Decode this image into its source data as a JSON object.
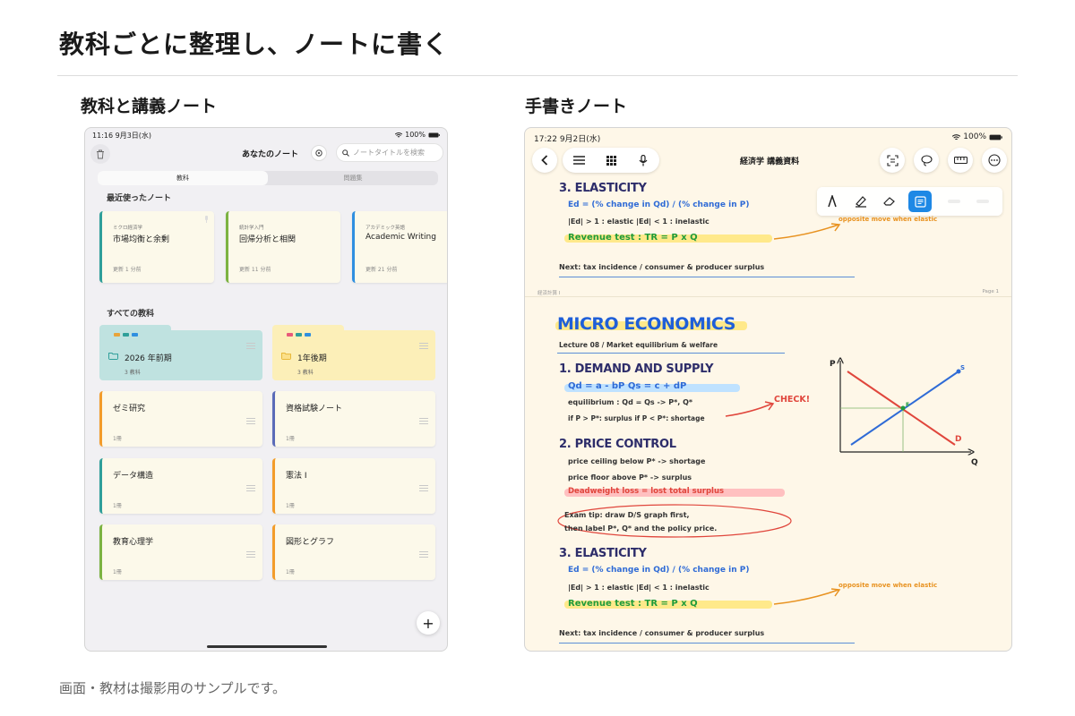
{
  "page": {
    "title": "教科ごとに整理し、ノートに書く",
    "left_section_title": "教科と講義ノート",
    "right_section_title": "手書きノート",
    "footnote": "画面・教材は撮影用のサンプルです。"
  },
  "left_device": {
    "status": {
      "time": "11:16",
      "date": "9月3日(水)",
      "battery": "100%"
    },
    "header_title": "あなたのノート",
    "search_placeholder": "ノートタイトルを検索",
    "segments": [
      "教科",
      "問題集"
    ],
    "recent_label": "最近使ったノート",
    "recent_notes": [
      {
        "subject": "ミクロ経済学",
        "name": "市場均衡と余剰",
        "updated": "更新 1 分前",
        "color": "#2f9f9a"
      },
      {
        "subject": "統計学入門",
        "name": "回帰分析と相関",
        "updated": "更新 11 分前",
        "color": "#7cb342"
      },
      {
        "subject": "アカデミック英語",
        "name": "Academic Writing",
        "updated": "更新 21 分前",
        "color": "#2f8fe0"
      }
    ],
    "all_subjects_label": "すべての教科",
    "folders": [
      {
        "name": "2026 年前期",
        "count": "3 教科",
        "color": "#bfe2e0"
      },
      {
        "name": "1年後期",
        "count": "3 教科",
        "color": "#fcefb8"
      }
    ],
    "subjects": [
      {
        "name": "ゼミ研究",
        "count": "1冊",
        "color": "#f39c2a"
      },
      {
        "name": "資格試験ノート",
        "count": "1冊",
        "color": "#5b6bb8"
      },
      {
        "name": "データ構造",
        "count": "1冊",
        "color": "#2f9f9a"
      },
      {
        "name": "憲法 I",
        "count": "1冊",
        "color": "#f39c2a"
      },
      {
        "name": "教育心理学",
        "count": "1冊",
        "color": "#7cb342"
      },
      {
        "name": "図形とグラフ",
        "count": "1冊",
        "color": "#f39c2a"
      }
    ],
    "fab": "+"
  },
  "right_device": {
    "status": {
      "time": "17:22",
      "date": "9月2日(水)",
      "battery": "100%"
    },
    "header_title": "経済学 講義資料",
    "page_label_left": "経済計算 I",
    "page_label_right": "Page 1",
    "top_block": {
      "heading": "3. ELASTICITY",
      "line1": "Ed = (% change in Qd) / (% change in P)",
      "line2": "|Ed| > 1 : elastic    |Ed| < 1 : inelastic",
      "line3": "Revenue test :  TR = P x Q",
      "note": "opposite move when elastic",
      "next": "Next: tax incidence / consumer & producer surplus"
    },
    "main": {
      "title": "MICRO ECONOMICS",
      "subtitle": "Lecture 08 / Market equilibrium & welfare",
      "h1": "1. DEMAND AND SUPPLY",
      "eq1": "Qd = a - bP      Qs = c + dP",
      "eq2": "equilibrium :  Qd = Qs  ->  P*, Q*",
      "eq3": "if P > P*: surplus     if P < P*: shortage",
      "check": "CHECK!",
      "h2": "2. PRICE CONTROL",
      "pc1": "price ceiling below P*  -> shortage",
      "pc2": "price floor above P*   -> surplus",
      "pc3": "Deadweight loss = lost total surplus",
      "tip1": "Exam tip: draw D/S graph first,",
      "tip2": "then label P*, Q* and the policy price.",
      "h3": "3. ELASTICITY",
      "el1": "Ed = (% change in Qd) / (% change in P)",
      "el2": "|Ed| > 1 : elastic    |Ed| < 1 : inelastic",
      "el3": "Revenue test :  TR = P x Q",
      "el_note": "opposite move when elastic",
      "el_next": "Next: tax incidence / consumer & producer surplus"
    },
    "graph": {
      "p_label": "P",
      "q_label": "Q",
      "d_label": "D",
      "s_label": "S",
      "e_label": "E"
    }
  }
}
